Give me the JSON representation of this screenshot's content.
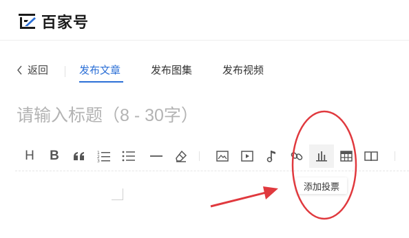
{
  "app": {
    "logo_text": "百家号"
  },
  "nav": {
    "back_label": "返回",
    "tabs": [
      {
        "label": "发布文章",
        "active": true
      },
      {
        "label": "发布图集",
        "active": false
      },
      {
        "label": "发布视频",
        "active": false
      }
    ]
  },
  "editor": {
    "title_placeholder": "请输入标题（8 - 30字）",
    "title_value": ""
  },
  "toolbar": {
    "items": [
      {
        "name": "heading",
        "icon": "heading-icon",
        "label": "H"
      },
      {
        "name": "bold",
        "icon": "bold-icon",
        "label": "B"
      },
      {
        "name": "quote",
        "icon": "quote-icon"
      },
      {
        "name": "ordered-list",
        "icon": "ordered-list-icon"
      },
      {
        "name": "unordered-list",
        "icon": "unordered-list-icon"
      },
      {
        "name": "divider",
        "icon": "horizontal-rule-icon"
      },
      {
        "name": "clear-format",
        "icon": "eraser-icon"
      },
      {
        "name": "image",
        "icon": "image-icon"
      },
      {
        "name": "video",
        "icon": "video-icon"
      },
      {
        "name": "audio",
        "icon": "music-icon"
      },
      {
        "name": "link",
        "icon": "link-icon"
      },
      {
        "name": "vote",
        "icon": "bar-chart-icon",
        "highlighted": true
      },
      {
        "name": "table",
        "icon": "table-icon"
      },
      {
        "name": "book",
        "icon": "book-icon"
      }
    ],
    "tooltip": "添加投票"
  },
  "colors": {
    "accent": "#2b6fd6",
    "annotation": "#e0393e",
    "placeholder": "#b3b3b3"
  }
}
